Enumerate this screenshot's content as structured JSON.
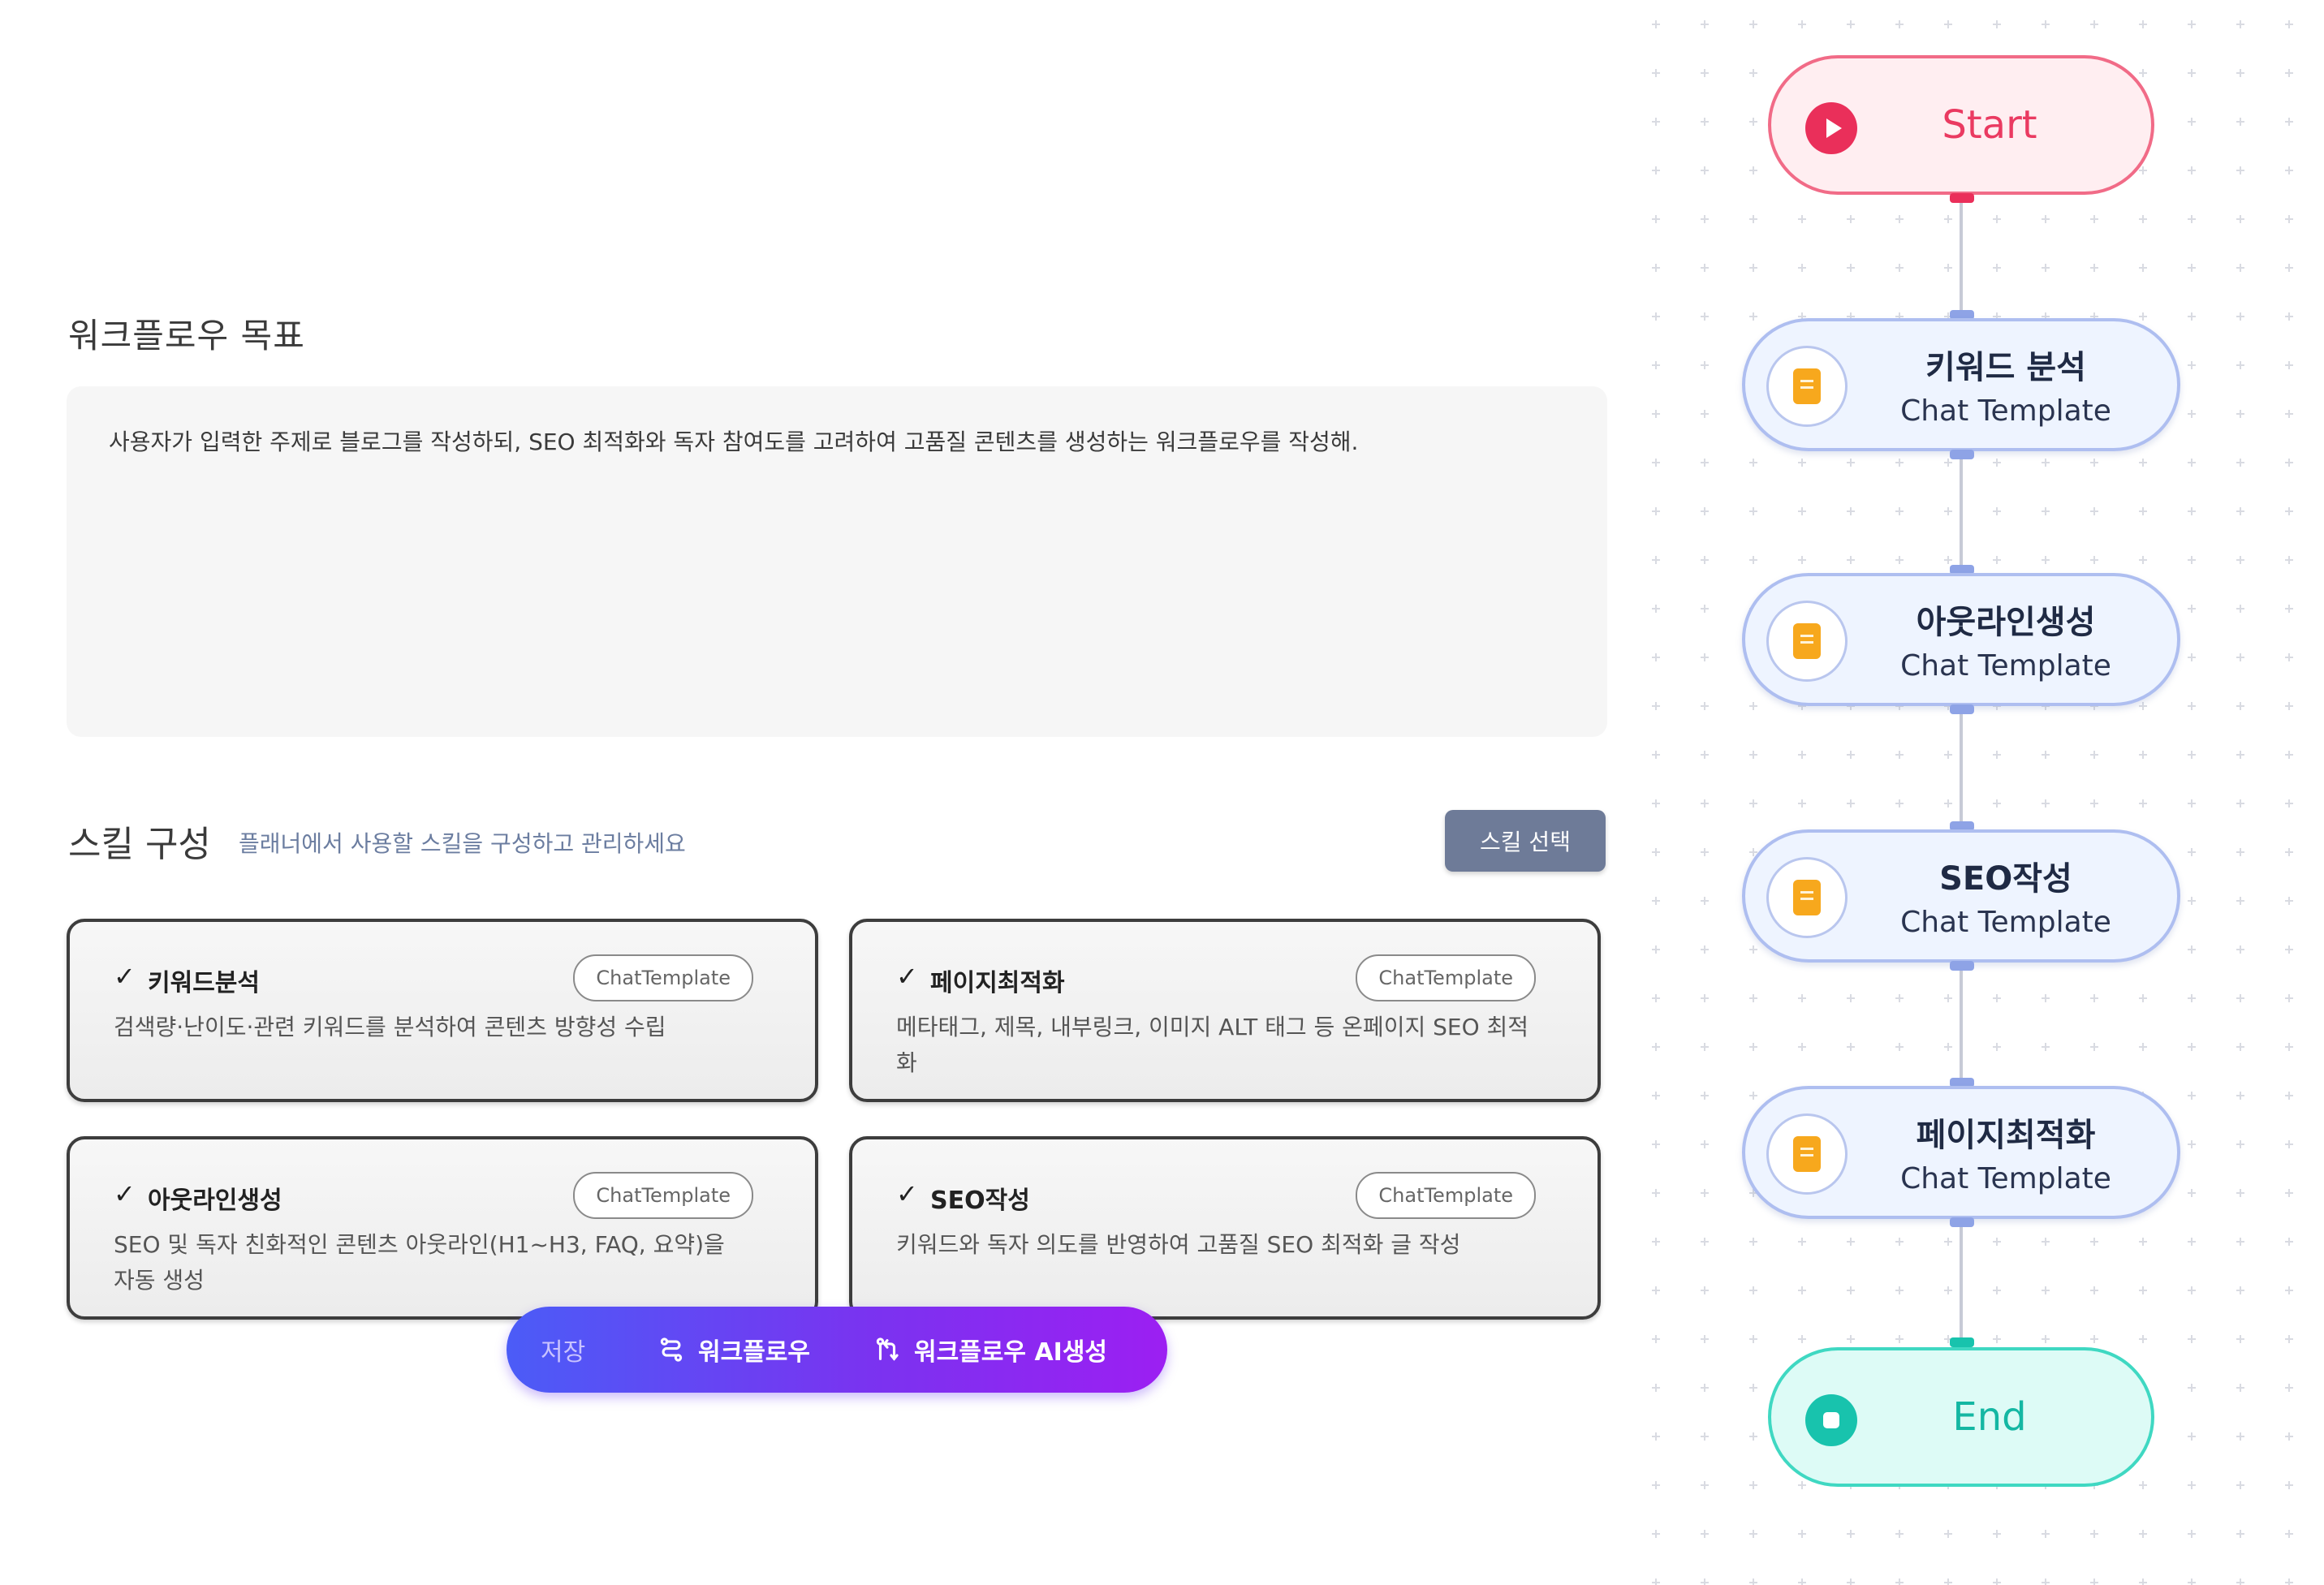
{
  "goal": {
    "title": "워크플로우 목표",
    "text": "사용자가 입력한 주제로 블로그를 작성하되, SEO 최적화와 독자 참여도를 고려하여 고품질 콘텐츠를 생성하는 워크플로우를 작성해."
  },
  "skills": {
    "title": "스킬 구성",
    "subtitle": "플래너에서 사용할 스킬을 구성하고 관리하세요",
    "select_label": "스킬 선택",
    "check": "✓",
    "cards": [
      {
        "name": "키워드분석",
        "tag": "ChatTemplate",
        "desc": "검색량·난이도·관련 키워드를 분석하여 콘텐츠 방향성 수립"
      },
      {
        "name": "페이지최적화",
        "tag": "ChatTemplate",
        "desc": "메타태그, 제목, 내부링크, 이미지 ALT 태그 등 온페이지 SEO 최적화"
      },
      {
        "name": "아웃라인생성",
        "tag": "ChatTemplate",
        "desc": "SEO 및 독자 친화적인 콘텐츠 아웃라인(H1~H3, FAQ, 요약)을 자동 생성"
      },
      {
        "name": "SEO작성",
        "tag": "ChatTemplate",
        "desc": "키워드와 독자 의도를 반영하여 고품질 SEO 최적화 글 작성"
      }
    ]
  },
  "toolbar": {
    "save_label": "저장",
    "workflow_label": "워크플로우",
    "ai_label": "워크플로우 AI생성"
  },
  "flow": {
    "start_label": "Start",
    "end_label": "End",
    "nodes": [
      {
        "title": "키워드 분석",
        "type": "Chat Template"
      },
      {
        "title": "아웃라인생성",
        "type": "Chat Template"
      },
      {
        "title": "SEO작성",
        "type": "Chat Template"
      },
      {
        "title": "페이지최적화",
        "type": "Chat Template"
      }
    ]
  },
  "colors": {
    "toolbar_gradient_start": "#4b5cf7",
    "toolbar_gradient_end": "#9c1ff2",
    "start_accent": "#ea2f5a",
    "end_accent": "#18c3ad",
    "node_border": "#aebef0",
    "doc_icon": "#f7a81d",
    "skill_select_bg": "#6e7b98"
  },
  "icons": {
    "start": "play-circle-icon",
    "end": "stop-circle-icon",
    "node": "document-icon",
    "workflow": "workflow-icon",
    "ai": "branch-merge-icon"
  }
}
